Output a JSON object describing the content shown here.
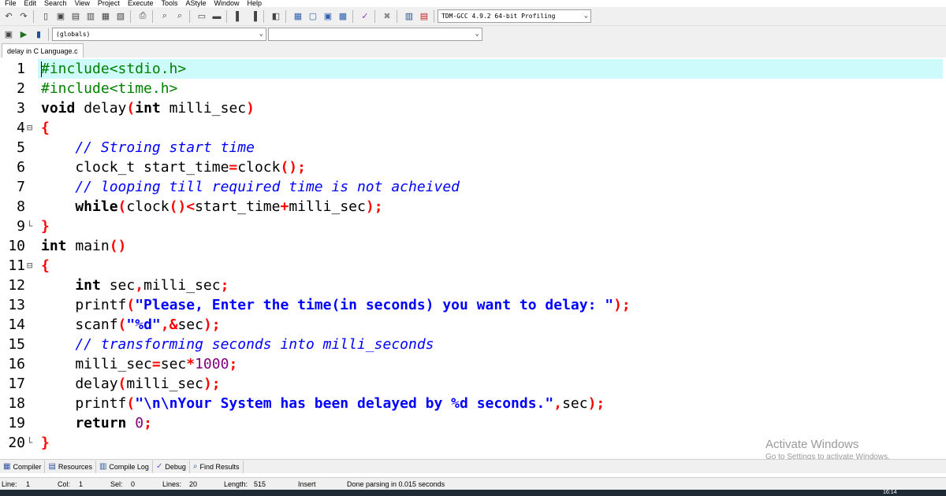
{
  "menu": [
    "File",
    "Edit",
    "Search",
    "View",
    "Project",
    "Execute",
    "Tools",
    "AStyle",
    "Window",
    "Help"
  ],
  "toolbar": {
    "compiler_select": "TDM-GCC 4.9.2 64-bit Profiling",
    "scope_select": "(globals)",
    "member_select": ""
  },
  "tab": {
    "label": "delay in C Language.c"
  },
  "code_lines": [
    {
      "num": "1",
      "fold": ""
    },
    {
      "num": "2",
      "fold": ""
    },
    {
      "num": "3",
      "fold": ""
    },
    {
      "num": "4",
      "fold": "⊟"
    },
    {
      "num": "5",
      "fold": ""
    },
    {
      "num": "6",
      "fold": ""
    },
    {
      "num": "7",
      "fold": ""
    },
    {
      "num": "8",
      "fold": ""
    },
    {
      "num": "9",
      "fold": "└"
    },
    {
      "num": "10",
      "fold": ""
    },
    {
      "num": "11",
      "fold": "⊟"
    },
    {
      "num": "12",
      "fold": ""
    },
    {
      "num": "13",
      "fold": ""
    },
    {
      "num": "14",
      "fold": ""
    },
    {
      "num": "15",
      "fold": ""
    },
    {
      "num": "16",
      "fold": ""
    },
    {
      "num": "17",
      "fold": ""
    },
    {
      "num": "18",
      "fold": ""
    },
    {
      "num": "19",
      "fold": ""
    },
    {
      "num": "20",
      "fold": "└"
    }
  ],
  "code": {
    "l1": "#include<stdio.h>",
    "l2": "#include<time.h>",
    "l3_kw": "void",
    "l3_a": " delay",
    "l3_b": "(",
    "l3_kw2": "int",
    "l3_c": " milli_sec",
    "l3_d": ")",
    "l4": "{",
    "l5": "    // Stroing start time",
    "l6_a": "    clock_t start_time",
    "l6_b": "=",
    "l6_c": "clock",
    "l6_d": "();",
    "l7": "    // looping till required time is not acheived",
    "l8_kw": "    while",
    "l8_a": "(",
    "l8_b": "clock",
    "l8_c": "()<",
    "l8_d": "start_time",
    "l8_e": "+",
    "l8_f": "milli_sec",
    "l8_g": ");",
    "l9": "}",
    "l10_kw": "int",
    "l10_a": " main",
    "l10_b": "()",
    "l11": "{",
    "l12_kw": "    int",
    "l12_a": " sec",
    "l12_b": ",",
    "l12_c": "milli_sec",
    "l12_d": ";",
    "l13_a": "    printf",
    "l13_b": "(",
    "l13_c": "\"Please, Enter the time(in seconds) you want to delay: \"",
    "l13_d": ");",
    "l14_a": "    scanf",
    "l14_b": "(",
    "l14_c": "\"%d\"",
    "l14_d": ",&",
    "l14_e": "sec",
    "l14_f": ");",
    "l15": "    // transforming seconds into milli_seconds",
    "l16_a": "    milli_sec",
    "l16_b": "=",
    "l16_c": "sec",
    "l16_d": "*",
    "l16_e": "1000",
    "l16_f": ";",
    "l17_a": "    delay",
    "l17_b": "(",
    "l17_c": "milli_sec",
    "l17_d": ");",
    "l18_a": "    printf",
    "l18_b": "(",
    "l18_c": "\"\\n\\nYour System has been delayed by %d seconds.\"",
    "l18_d": ",",
    "l18_e": "sec",
    "l18_f": ");",
    "l19_kw": "    return",
    "l19_a": " ",
    "l19_b": "0",
    "l19_c": ";",
    "l20": "}"
  },
  "watermark": {
    "title": "Activate Windows",
    "subtitle": "Go to Settings to activate Windows."
  },
  "bottom_tabs": [
    "Compiler",
    "Resources",
    "Compile Log",
    "Debug",
    "Find Results"
  ],
  "status": {
    "line_label": "Line:",
    "line_value": "1",
    "col_label": "Col:",
    "col_value": "1",
    "sel_label": "Sel:",
    "sel_value": "0",
    "lines_label": "Lines:",
    "lines_value": "20",
    "length_label": "Length:",
    "length_value": "515",
    "mode": "Insert",
    "message": "Done parsing in 0.015 seconds"
  },
  "taskbar": {
    "clock": "16:14"
  }
}
